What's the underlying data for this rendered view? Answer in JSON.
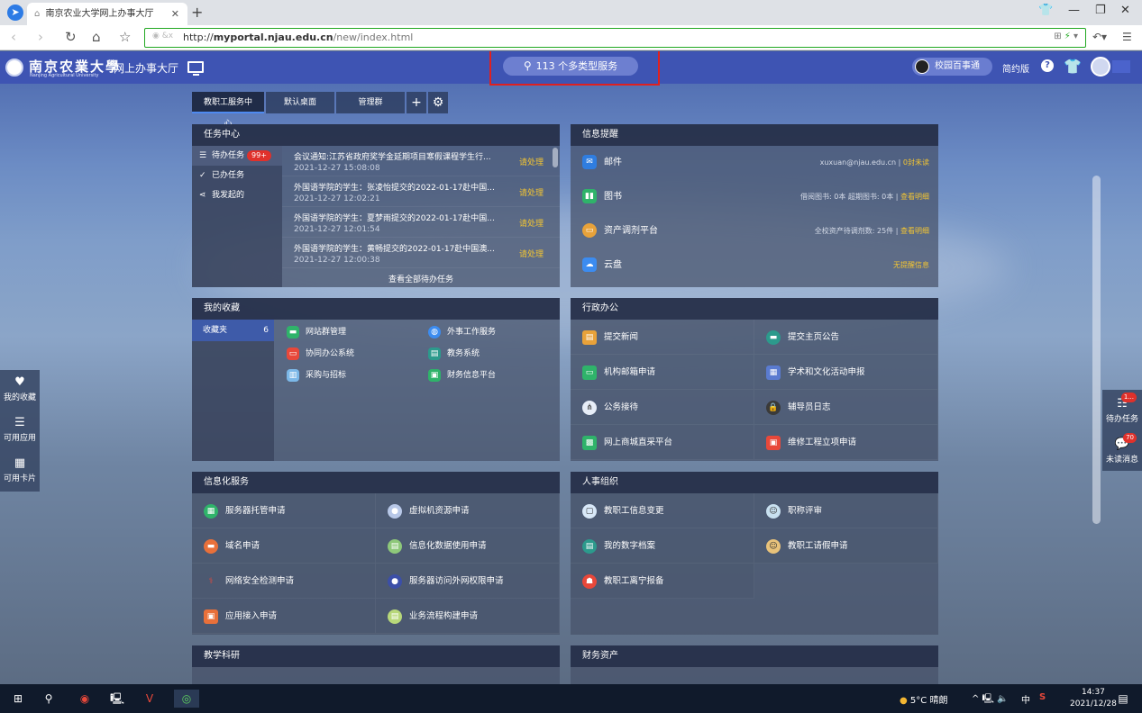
{
  "browser": {
    "tab_title": "南京农业大学网上办事大厅",
    "new_tab": "+",
    "url_prefix": "http://",
    "url_domain": "myportal.njau.edu.cn",
    "url_path": "/new/index.html"
  },
  "header": {
    "logo_cn": "南京农業大學",
    "logo_en": "Nanjing Agricultural University",
    "portal_title": "网上办事大厅",
    "search_text": "113 个多类型服务",
    "campus_label": "校园百事通",
    "simple_label": "简约版",
    "help_label": "?"
  },
  "desktop_tabs": [
    "教职工服务中心",
    "默认桌面",
    "管理群"
  ],
  "add_tab": "+",
  "tasks": {
    "title": "任务中心",
    "nav": [
      {
        "label": "待办任务",
        "badge": "99+"
      },
      {
        "label": "已办任务"
      },
      {
        "label": "我发起的"
      }
    ],
    "items": [
      {
        "title": "会议通知:江苏省政府奖学金延期项目寒假课程学生行...",
        "time": "2021-12-27 15:08:08",
        "action": "请处理"
      },
      {
        "title": "外国语学院的学生：张凌怡提交的2022-01-17赴中国...",
        "time": "2021-12-27 12:02:21",
        "action": "请处理"
      },
      {
        "title": "外国语学院的学生：夏梦雨提交的2022-01-17赴中国...",
        "time": "2021-12-27 12:01:54",
        "action": "请处理"
      },
      {
        "title": "外国语学院的学生：黄畅提交的2022-01-17赴中国澳...",
        "time": "2021-12-27 12:00:38",
        "action": "请处理"
      }
    ],
    "more": "查看全部待办任务"
  },
  "info": {
    "title": "信息提醒",
    "rows": [
      {
        "label": "邮件",
        "detail": "xuxuan@njau.edu.cn",
        "link": "0封未读"
      },
      {
        "label": "图书",
        "detail": "借阅图书: 0本 超期图书: 0本",
        "link": "查看明细"
      },
      {
        "label": "资产调剂平台",
        "detail": "全校资产待调剂数: 25件",
        "link": "查看明细"
      },
      {
        "label": "云盘",
        "detail": "",
        "link": "无提醒信息"
      }
    ],
    "sep": "|"
  },
  "favorites": {
    "title": "我的收藏",
    "folder": "收藏夹",
    "count": "6",
    "items": [
      "网站群管理",
      "外事工作服务",
      "协同办公系统",
      "教务系统",
      "采购与招标",
      "财务信息平台"
    ]
  },
  "admin": {
    "title": "行政办公",
    "items": [
      "提交新闻",
      "提交主页公告",
      "机构邮箱申请",
      "学术和文化活动申报",
      "公务接待",
      "辅导员日志",
      "网上商城直采平台",
      "维修工程立项申请"
    ]
  },
  "it": {
    "title": "信息化服务",
    "items": [
      "服务器托管申请",
      "虚拟机资源申请",
      "域名申请",
      "信息化数据使用申请",
      "网络安全检测申请",
      "服务器访问外网权限申请",
      "应用接入申请",
      "业务流程构建申请"
    ]
  },
  "hr": {
    "title": "人事组织",
    "items": [
      "教职工信息变更",
      "职称评审",
      "我的数字档案",
      "教职工请假申请",
      "教职工离宁报备"
    ]
  },
  "teaching": {
    "title": "教学科研"
  },
  "finance": {
    "title": "财务资产"
  },
  "side_left": [
    "我的收藏",
    "可用应用",
    "可用卡片"
  ],
  "side_right": [
    {
      "label": "待办任务",
      "badge": "1..."
    },
    {
      "label": "未读消息",
      "badge": "70"
    }
  ],
  "taskbar": {
    "weather": "5°C 晴朗",
    "ime": "中",
    "time": "14:37",
    "date": "2021/12/28"
  },
  "colors": {
    "topbar": "#3e54b3",
    "highlight": "#e0201f",
    "accent_yellow": "#f3c532",
    "badge_red": "#e0312b"
  }
}
